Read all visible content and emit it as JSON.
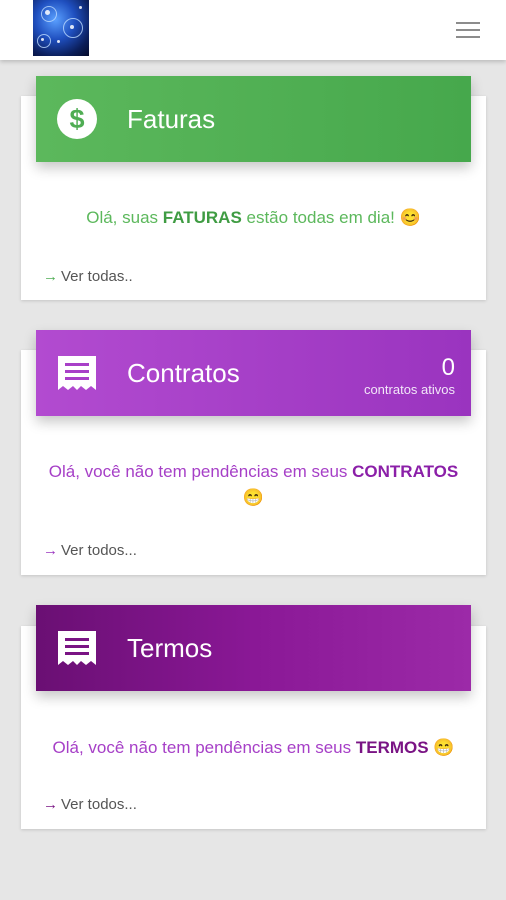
{
  "topbar": {
    "logo_icon": "app-logo-network",
    "menu_icon": "hamburger-menu-icon"
  },
  "colors": {
    "green": "#46a84c",
    "green_text": "#5cb85c",
    "purple": "#a33bc4",
    "purple_dark": "#6a0f73",
    "link_gray": "#555555"
  },
  "faturas": {
    "icon": "dollar-circle-icon",
    "title": "Faturas",
    "msg_before": "Olá, suas ",
    "msg_bold": "FATURAS",
    "msg_after": " estão todas em dia! 😊",
    "link_arrow": "→",
    "link": "Ver todas.."
  },
  "contratos": {
    "icon": "receipt-icon",
    "title": "Contratos",
    "count": "0",
    "count_label": "contratos ativos",
    "msg_before": "Olá, você não tem pendências em seus ",
    "msg_bold": "CONTRATOS",
    "msg_after": "😁",
    "link_arrow": "→",
    "link": "Ver todos..."
  },
  "termos": {
    "icon": "receipt-icon",
    "title": "Termos",
    "msg_before": "Olá, você não tem pendências em seus ",
    "msg_bold": "TERMOS",
    "msg_after": " 😁",
    "link_arrow": "→",
    "link": "Ver todos..."
  }
}
